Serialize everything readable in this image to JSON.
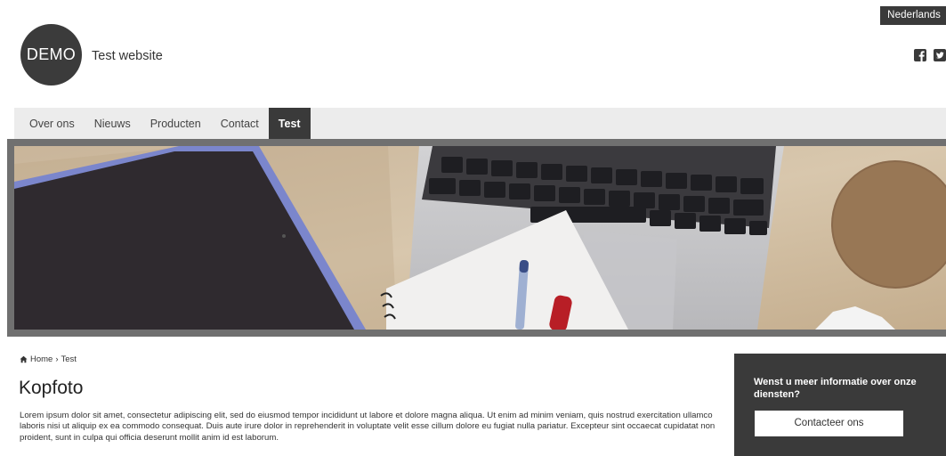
{
  "header": {
    "language": "Nederlands",
    "logo_text": "DEMO",
    "site_title": "Test website",
    "social_icons": [
      "facebook-icon",
      "twitter-icon"
    ]
  },
  "nav": {
    "items": [
      {
        "label": "Over ons",
        "active": false
      },
      {
        "label": "Nieuws",
        "active": false
      },
      {
        "label": "Producten",
        "active": false
      },
      {
        "label": "Contact",
        "active": false
      },
      {
        "label": "Test",
        "active": true
      }
    ]
  },
  "breadcrumb": {
    "home": "Home",
    "separator": "›",
    "current": "Test"
  },
  "main": {
    "title": "Kopfoto",
    "body": "Lorem ipsum dolor sit amet, consectetur adipiscing elit, sed do eiusmod tempor incididunt ut labore et dolore magna aliqua. Ut enim ad minim veniam, quis nostrud exercitation ullamco laboris nisi ut aliquip ex ea commodo consequat. Duis aute irure dolor in reprehenderit in voluptate velit esse cillum dolore eu fugiat nulla pariatur. Excepteur sint occaecat cupidatat non proident, sunt in culpa qui officia deserunt mollit anim id est laborum."
  },
  "sidebar": {
    "text": "Wenst u meer informatie over onze diensten?",
    "button": "Contacteer ons"
  },
  "colors": {
    "dark": "#3a3a3a",
    "nav_bg": "#ececec",
    "hero_frame": "#707070"
  }
}
